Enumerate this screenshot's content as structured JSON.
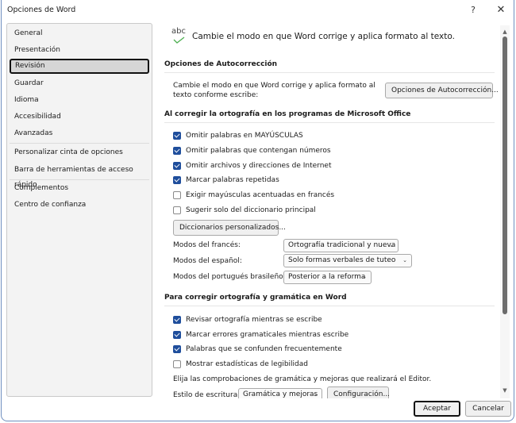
{
  "window": {
    "title": "Opciones de Word",
    "help_label": "?",
    "close_label": "✕"
  },
  "sidebar": {
    "items": [
      {
        "label": "General"
      },
      {
        "label": "Presentación"
      },
      {
        "label": "Revisión",
        "active": true
      },
      {
        "label": "Guardar"
      },
      {
        "label": "Idioma"
      },
      {
        "label": "Accesibilidad"
      },
      {
        "label": "Avanzadas"
      },
      {
        "label": "Personalizar cinta de opciones"
      },
      {
        "label": "Barra de herramientas de acceso rápido"
      },
      {
        "label": "Complementos"
      },
      {
        "label": "Centro de confianza"
      }
    ]
  },
  "content": {
    "icon_text": "abc",
    "intro": "Cambie el modo en que Word corrige y aplica formato al texto.",
    "autocorrect": {
      "heading": "Opciones de Autocorrección",
      "description": "Cambie el modo en que Word corrige y aplica formato al texto conforme escribe:",
      "button": "Opciones de Autocorrección..."
    },
    "office_spelling": {
      "heading": "Al corregir la ortografía en los programas de Microsoft Office",
      "checkboxes": [
        {
          "label": "Omitir palabras en MAYÚSCULAS",
          "checked": true
        },
        {
          "label": "Omitir palabras que contengan números",
          "checked": true
        },
        {
          "label": "Omitir archivos y direcciones de Internet",
          "checked": true
        },
        {
          "label": "Marcar palabras repetidas",
          "checked": true
        },
        {
          "label": "Exigir mayúsculas acentuadas en francés",
          "checked": false
        },
        {
          "label": "Sugerir solo del diccionario principal",
          "checked": false
        }
      ],
      "custom_dict_button": "Diccionarios personalizados...",
      "modes": [
        {
          "label": "Modos del francés:",
          "value": "Ortografía tradicional y nueva"
        },
        {
          "label": "Modos del español:",
          "value": "Solo formas verbales de tuteo"
        },
        {
          "label": "Modos del portugués brasileño:",
          "value": "Posterior a la reforma"
        }
      ]
    },
    "word_spelling": {
      "heading": "Para corregir ortografía y gramática en Word",
      "checkboxes": [
        {
          "label": "Revisar ortografía mientras se escribe",
          "checked": true
        },
        {
          "label": "Marcar errores gramaticales mientras escribe",
          "checked": true
        },
        {
          "label": "Palabras que se confunden frecuentemente",
          "checked": true
        },
        {
          "label": "Mostrar estadísticas de legibilidad",
          "checked": false
        }
      ],
      "editor_text": "Elija las comprobaciones de gramática y mejoras que realizará el Editor.",
      "writing_style_label": "Estilo de escritura:",
      "writing_style_value": "Gramática y mejoras",
      "settings_button": "Configuración..."
    }
  },
  "footer": {
    "ok": "Aceptar",
    "cancel": "Cancelar"
  },
  "colors": {
    "checkbox_checked": "#1f4e9c",
    "check_icon": "#4caf50"
  }
}
